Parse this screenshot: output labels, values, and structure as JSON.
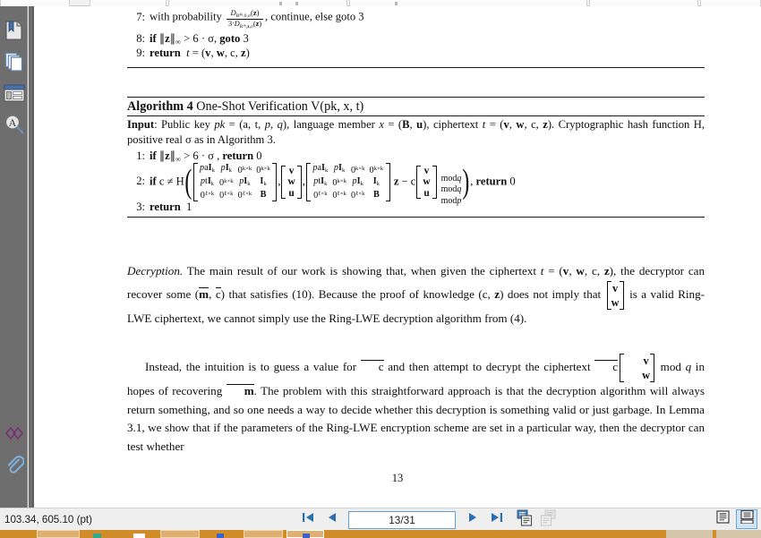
{
  "app": {
    "name": "pdf-viewer",
    "document_background": "#ffffff",
    "sidebar_color": "#6e6e6e",
    "accent_color": "#5f9fd4",
    "highlight_color": "#cfe4f7",
    "taskbar_color": "#cf8c28"
  },
  "sidebar": {
    "items": [
      {
        "name": "thumbnails",
        "icon": "bookmark-page-icon",
        "label": "Thumbnails"
      },
      {
        "name": "pages",
        "icon": "copy-pages-icon",
        "label": "Pages"
      },
      {
        "name": "layers",
        "icon": "layout-panel-icon",
        "label": "Layers"
      },
      {
        "name": "find-text",
        "icon": "text-search-icon",
        "label": "Find Text"
      }
    ],
    "bottom_items": [
      {
        "name": "links",
        "icon": "chain-link-icon",
        "label": "Links"
      },
      {
        "name": "attachments",
        "icon": "paperclip-icon",
        "label": "Attachments"
      }
    ]
  },
  "statusbar": {
    "coordinates": "103.34, 605.10 (pt)",
    "nav": {
      "first_page": "first-page",
      "previous_page": "previous-page",
      "page_value": "13/31",
      "page_placeholder": "13/31",
      "next_page": "next-page",
      "last_page": "last-page",
      "add_page": "add-page",
      "remove_page": "remove-page"
    },
    "view_modes": [
      {
        "name": "single-page-view",
        "active": false
      },
      {
        "name": "continuous-page-view",
        "active": true
      }
    ]
  },
  "document": {
    "page_number": "13",
    "algorithm3_tail": {
      "lines": [
        {
          "num": "7:",
          "text_before": "with probability",
          "frac_num": "D",
          "frac_num_sub": "R4k,0,σ",
          "frac_num_arg": "(z)",
          "frac_den": "3·D",
          "frac_den_sub": "R4k,z,σ",
          "frac_den_arg": "(z)",
          "text_after": ", continue, else goto 3"
        },
        {
          "num": "8:",
          "text": "if ‖z‖∞ > 6 · σ, goto 3"
        },
        {
          "num": "9:",
          "text": "return  t = (v, w, c, z)"
        }
      ]
    },
    "algorithm4": {
      "title_bold": "Algorithm 4",
      "title_rest": "One-Shot Verification V(pk, x, t)",
      "input_label": "Input",
      "input_text": ": Public key pk = (a, t, p, q), language member x = (B, u), ciphertext t = (v, w, c, z). Cryptographic hash function H, positive real σ as in Algorithm 3.",
      "line1_num": "1:",
      "line1_text": "if ‖z‖∞ > 6 · σ , return 0",
      "line2_num": "2:",
      "line2_prefix": "if c ≠ H",
      "matrix_rows": [
        [
          "paI",
          "pI",
          "0",
          "0"
        ],
        [
          "ptI",
          "0",
          "pI",
          "I"
        ],
        [
          "0",
          "0",
          "0",
          "B"
        ]
      ],
      "matrix_row_subs": [
        [
          "k",
          "k",
          "k×k",
          "k×k"
        ],
        [
          "k",
          "k×k",
          "k",
          "k"
        ],
        [
          "ℓ×k",
          "ℓ×k",
          "ℓ×k",
          ""
        ]
      ],
      "vector_vwu": [
        "v",
        "w",
        "u"
      ],
      "mid_operator": "z − c",
      "mod_column": [
        "mod q",
        "mod q",
        "mod p"
      ],
      "line2_suffix": ", return 0",
      "line3_num": "3:",
      "line3_text": "return  1"
    },
    "paragraphs": [
      {
        "name": "decryption-paragraph",
        "lead_italic": "Decryption.",
        "segments": [
          " The main result of our work is showing that, when given the ciphertext t = (v, w, c, z), the decryptor can recover some (m̄, c̄) that satisfies (10). Because the proof of knowledge (c, z) does not imply that ",
          " is a valid Ring-LWE ciphertext, we cannot simply use the Ring-LWE decryption algorithm from (4)."
        ],
        "inline_vector": [
          "v",
          "w"
        ]
      },
      {
        "name": "instead-paragraph",
        "segments": [
          "Instead, the intuition is to guess a value for c̄ and then attempt to decrypt the ciphertext c̄ ",
          " mod q in hopes of recovering m̄. The problem with this straightforward approach is that the decryption algorithm will always return something, and so one needs a way to decide whether this decryption is something valid or just garbage. In Lemma 3.1, we show that if the parameters of the Ring-LWE encryption scheme are set in a particular way, then the decryptor can test whether"
        ],
        "inline_vector": [
          "v",
          "w"
        ]
      }
    ]
  }
}
